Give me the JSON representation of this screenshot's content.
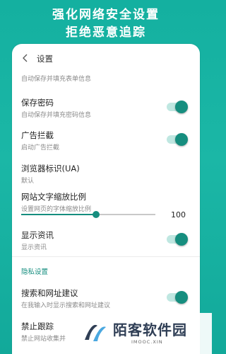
{
  "headline": {
    "line1": "强化网络安全设置",
    "line2": "拒绝恶意追踪"
  },
  "nav": {
    "title": "设置",
    "back_icon": "chevron-left-icon"
  },
  "partial_item": {
    "subtitle": "自动保存并填充表单信息"
  },
  "items": [
    {
      "title": "保存密码",
      "subtitle": "自动保存并填充密码信息",
      "toggle_on": true
    },
    {
      "title": "广告拦截",
      "subtitle": "启动广告拦截",
      "toggle_on": true
    },
    {
      "title": "浏览器标识(UA)",
      "subtitle": "默认"
    },
    {
      "title": "网站文字缩放比例",
      "subtitle": "设置网页的字体缩放比例",
      "slider_value": 100,
      "slider_fraction": 0.56
    },
    {
      "title": "显示资讯",
      "subtitle": "显示资讯",
      "toggle_on": true
    }
  ],
  "privacy_section": "隐私设置",
  "privacy_items": [
    {
      "title": "搜索和网址建议",
      "subtitle": "在我输入时显示搜索和网址建议",
      "toggle_on": true
    },
    {
      "title": "禁止跟踪",
      "subtitle": "禁止网站收集并"
    }
  ],
  "watermark": {
    "text": "陌客软件园",
    "sub": "IMOOC.XIN"
  },
  "colors": {
    "accent": "#168e7f",
    "background": "#14b0a0"
  }
}
